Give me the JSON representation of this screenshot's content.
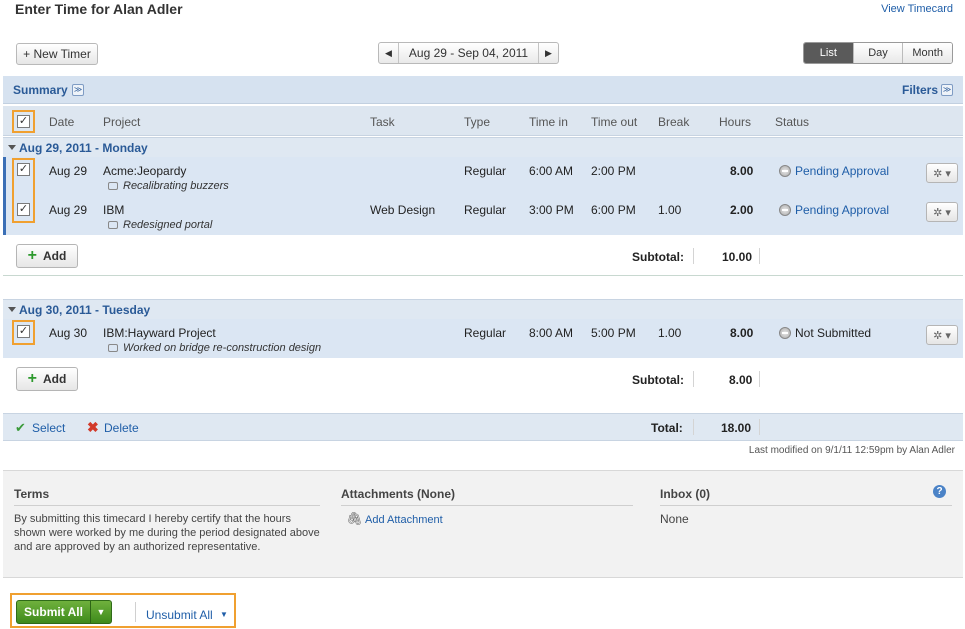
{
  "header": {
    "title": "Enter Time for Alan Adler",
    "view_timecard": "View Timecard"
  },
  "toolbar": {
    "new_timer": "+ New Timer",
    "date_range": "Aug 29 - Sep 04, 2011",
    "views": [
      "List",
      "Day",
      "Month"
    ],
    "active_view": "List"
  },
  "summary": {
    "label": "Summary",
    "filters": "Filters"
  },
  "columns": {
    "date": "Date",
    "project": "Project",
    "task": "Task",
    "type": "Type",
    "time_in": "Time in",
    "time_out": "Time out",
    "break": "Break",
    "hours": "Hours",
    "status": "Status"
  },
  "days": [
    {
      "header": "Aug 29, 2011 - Monday",
      "entries": [
        {
          "date": "Aug 29",
          "project": "Acme:Jeopardy",
          "note": "Recalibrating buzzers",
          "task": "",
          "type": "Regular",
          "time_in": "6:00 AM",
          "time_out": "2:00 PM",
          "break": "",
          "hours": "8.00",
          "status": "Pending Approval"
        },
        {
          "date": "Aug 29",
          "project": "IBM",
          "note": "Redesigned portal",
          "task": "Web Design",
          "type": "Regular",
          "time_in": "3:00 PM",
          "time_out": "6:00 PM",
          "break": "1.00",
          "hours": "2.00",
          "status": "Pending Approval"
        }
      ],
      "add_label": "Add",
      "subtotal_label": "Subtotal:",
      "subtotal": "10.00"
    },
    {
      "header": "Aug 30, 2011 - Tuesday",
      "entries": [
        {
          "date": "Aug 30",
          "project": "IBM:Hayward Project",
          "note": "Worked on bridge re-construction design",
          "task": "",
          "type": "Regular",
          "time_in": "8:00 AM",
          "time_out": "5:00 PM",
          "break": "1.00",
          "hours": "8.00",
          "status": "Not Submitted"
        }
      ],
      "add_label": "Add",
      "subtotal_label": "Subtotal:",
      "subtotal": "8.00"
    }
  ],
  "footer": {
    "select": "Select",
    "delete": "Delete",
    "total_label": "Total:",
    "total": "18.00",
    "last_modified": "Last modified on 9/1/11 12:59pm by Alan Adler"
  },
  "panels": {
    "terms_title": "Terms",
    "terms_text": "By submitting this timecard I hereby certify that the hours shown were worked by me during the period designated above and are approved by an authorized representative.",
    "attachments_title": "Attachments (None)",
    "add_attachment": "Add Attachment",
    "inbox_title": "Inbox (0)",
    "inbox_value": "None"
  },
  "actions": {
    "submit_all": "Submit All",
    "unsubmit_all": "Unsubmit All"
  },
  "colors": {
    "accent": "#2a5a97",
    "highlight": "#f0a030",
    "submit": "#4a961f",
    "row_bg": "#dbe6f3"
  },
  "checkbox_glyph": "✓"
}
